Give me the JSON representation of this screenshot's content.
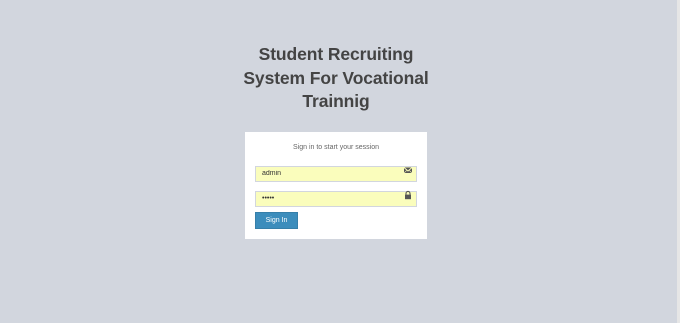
{
  "login": {
    "title_line1": "Student Recruiting",
    "title_line2": "System For Vocational",
    "title_line3": "Trainnig",
    "message": "Sign in to start your session",
    "username_value": "admin",
    "password_value": "•••••",
    "signin_label": "Sign In",
    "username_icon": "envelope-icon",
    "password_icon": "lock-icon"
  },
  "colors": {
    "background": "#d2d6de",
    "card": "#ffffff",
    "input_autofill": "#fafdbc",
    "button": "#3c8dbc",
    "title": "#444444"
  }
}
